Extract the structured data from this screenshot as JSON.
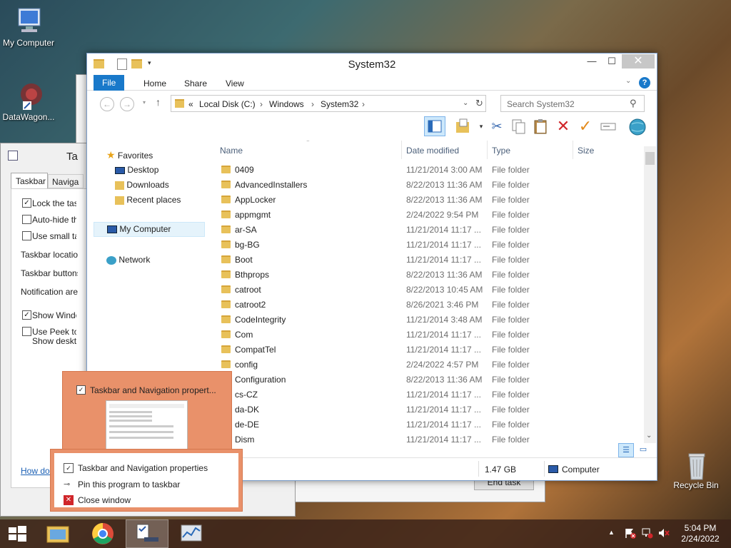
{
  "desktop": {
    "icons": [
      {
        "label": "My Computer"
      },
      {
        "label": "DataWagon..."
      },
      {
        "label": "Recycle Bin"
      }
    ]
  },
  "bg_window": {
    "title_fragment": "Ta",
    "tabs": [
      "Taskbar",
      "Naviga"
    ],
    "opts": [
      "Lock the task",
      "Auto-hide th",
      "Use small ta"
    ],
    "labels": [
      "Taskbar location",
      "Taskbar buttons",
      "Notification area"
    ],
    "opts2": [
      "Show Windo",
      "Use Peek to",
      "Show deskto"
    ],
    "link": "How do I",
    "end_task": "End task"
  },
  "explorer": {
    "title": "System32",
    "ribbon_tabs": [
      "File",
      "Home",
      "Share",
      "View"
    ],
    "breadcrumb": [
      "«",
      "Local Disk (C:)",
      "Windows",
      "System32"
    ],
    "search_placeholder": "Search System32",
    "nav": {
      "favorites": "Favorites",
      "desktop": "Desktop",
      "downloads": "Downloads",
      "recent": "Recent places",
      "computer": "My Computer",
      "network": "Network"
    },
    "columns": [
      "Name",
      "Date modified",
      "Type",
      "Size"
    ],
    "files": [
      {
        "name": "0409",
        "date": "11/21/2014 3:00 AM",
        "type": "File folder"
      },
      {
        "name": "AdvancedInstallers",
        "date": "8/22/2013 11:36 AM",
        "type": "File folder"
      },
      {
        "name": "AppLocker",
        "date": "8/22/2013 11:36 AM",
        "type": "File folder"
      },
      {
        "name": "appmgmt",
        "date": "2/24/2022 9:54 PM",
        "type": "File folder"
      },
      {
        "name": "ar-SA",
        "date": "11/21/2014 11:17 ...",
        "type": "File folder"
      },
      {
        "name": "bg-BG",
        "date": "11/21/2014 11:17 ...",
        "type": "File folder"
      },
      {
        "name": "Boot",
        "date": "11/21/2014 11:17 ...",
        "type": "File folder"
      },
      {
        "name": "Bthprops",
        "date": "8/22/2013 11:36 AM",
        "type": "File folder"
      },
      {
        "name": "catroot",
        "date": "8/22/2013 10:45 AM",
        "type": "File folder"
      },
      {
        "name": "catroot2",
        "date": "8/26/2021 3:46 PM",
        "type": "File folder"
      },
      {
        "name": "CodeIntegrity",
        "date": "11/21/2014 3:48 AM",
        "type": "File folder"
      },
      {
        "name": "Com",
        "date": "11/21/2014 11:17 ...",
        "type": "File folder"
      },
      {
        "name": "CompatTel",
        "date": "11/21/2014 11:17 ...",
        "type": "File folder"
      },
      {
        "name": "config",
        "date": "2/24/2022 4:57 PM",
        "type": "File folder"
      },
      {
        "name": "Configuration",
        "date": "8/22/2013 11:36 AM",
        "type": "File folder"
      },
      {
        "name": "cs-CZ",
        "date": "11/21/2014 11:17 ...",
        "type": "File folder"
      },
      {
        "name": "da-DK",
        "date": "11/21/2014 11:17 ...",
        "type": "File folder"
      },
      {
        "name": "de-DE",
        "date": "11/21/2014 11:17 ...",
        "type": "File folder"
      },
      {
        "name": "Dism",
        "date": "11/21/2014 11:17 ...",
        "type": "File folder"
      }
    ],
    "status_size": "1.47 GB",
    "status_location": "Computer"
  },
  "jumplist": {
    "thumb_title": "Taskbar and Navigation propert...",
    "items": [
      "Taskbar and Navigation properties",
      "Pin this program to taskbar",
      "Close window"
    ]
  },
  "taskbar": {
    "time": "5:04 PM",
    "date": "2/24/2022"
  }
}
